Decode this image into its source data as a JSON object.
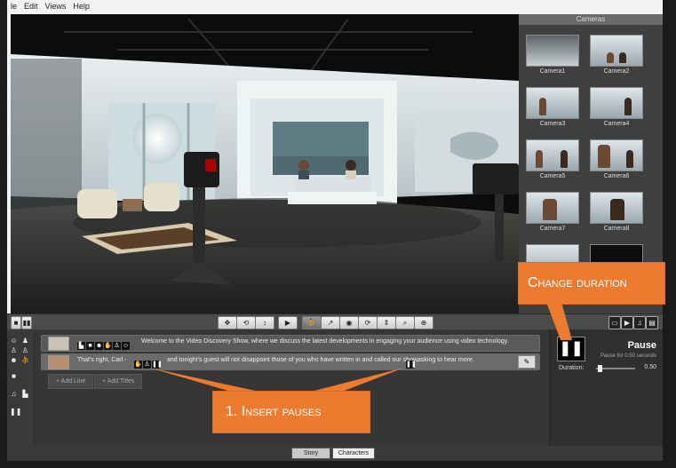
{
  "menu": {
    "file": "le",
    "edit": "Edit",
    "views": "Views",
    "help": "Help"
  },
  "cameras": {
    "title": "Cameras",
    "items": [
      "Camera1",
      "Camera2",
      "Camera3",
      "Camera4",
      "Camera5",
      "Camera6",
      "Camera7",
      "Camera8"
    ]
  },
  "lines": [
    {
      "text": "Welcome to the Video Discovery Show, where we discuss the latest developments in engaging your audience using video technology."
    },
    {
      "text_a": "That's right, Carl -",
      "text_b": "and tonight's guest will not disappoint those of you who have written in and called our show,",
      "text_c": "asking to hear more."
    }
  ],
  "buttons": {
    "add_line": "+ Add Line",
    "add_titles": "+ Add Titles"
  },
  "properties": {
    "title": "Pause",
    "subtitle": "Pause for 0.50 seconds",
    "duration_label": "Duration:",
    "duration_value": "0.50",
    "duration_fraction": 0.05
  },
  "tabs": {
    "story": "Story",
    "characters": "Characters"
  },
  "callouts": {
    "change_duration": "Change duration",
    "insert_pauses": "1. Insert pauses"
  },
  "colors": {
    "accent": "#ec7a2f"
  }
}
